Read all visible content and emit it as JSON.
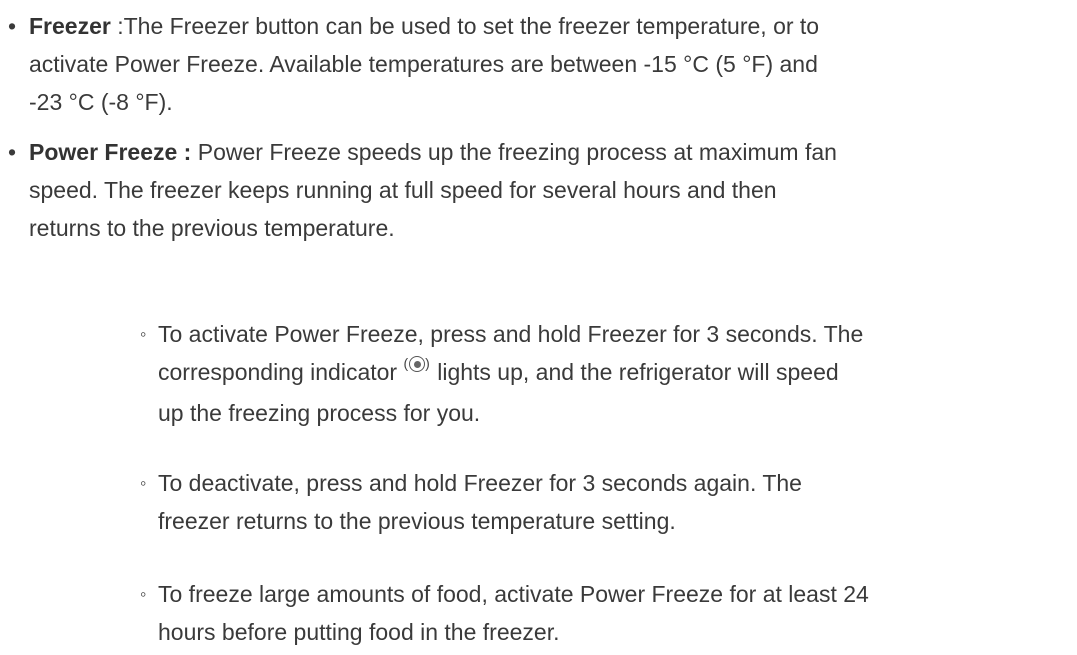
{
  "items": [
    {
      "term": "Freezer",
      "lines": [
        " :The Freezer button can be used to set the freezer temperature, or to",
        "activate Power Freeze. Available temperatures are between -15 °C (5 °F) and",
        "-23 °C (-8 °F)."
      ]
    },
    {
      "term": "Power Freeze :",
      "lines": [
        " Power Freeze speeds up the freezing process at maximum fan",
        "speed. The freezer keeps running at full speed for several hours and then",
        "returns to the previous temperature."
      ]
    }
  ],
  "subitems": [
    {
      "line1": "To activate Power Freeze, press and hold Freezer for 3 seconds. The",
      "line2_before": "corresponding indicator ",
      "line2_after": " lights up, and the refrigerator will speed",
      "line3": "up the freezing process for you."
    },
    {
      "line1": "To deactivate, press and hold Freezer for 3 seconds again. The",
      "line2": "freezer returns to the previous temperature setting."
    },
    {
      "line1": "To freeze large amounts of food, activate Power Freeze for at least 24",
      "line2": "hours before putting food in the freezer."
    }
  ],
  "bullet_char": "•",
  "sub_bullet_char": "◦",
  "indicator_icon_name": "power-freeze-indicator-icon"
}
